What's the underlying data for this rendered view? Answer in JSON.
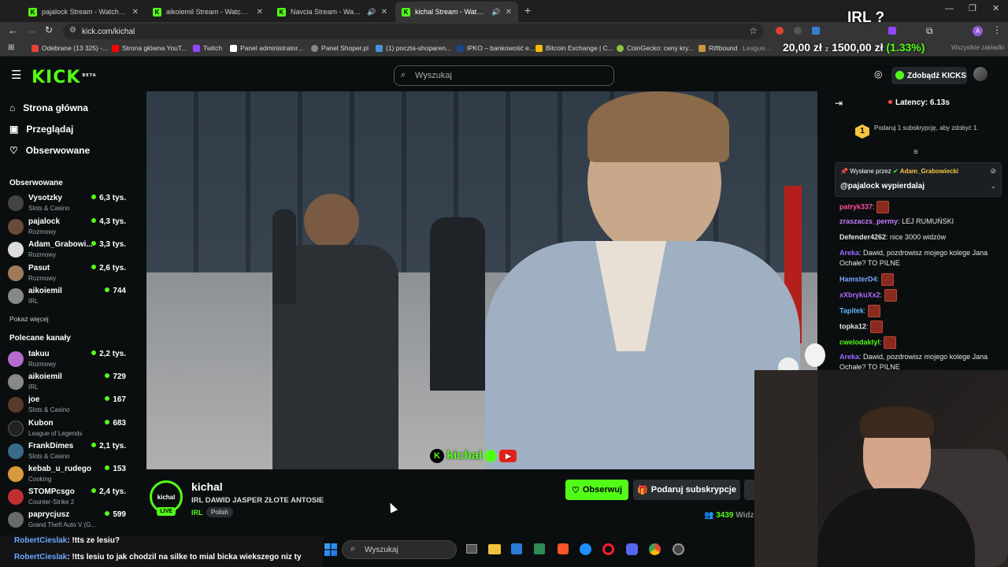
{
  "browser": {
    "tabs": [
      {
        "title": "pajalock Stream - Watch Live on",
        "active": false
      },
      {
        "title": "aikoiemil Stream - Watch Live o",
        "active": false
      },
      {
        "title": "Navcia Stream - Watch Live on",
        "active": false
      },
      {
        "title": "kichal Stream - Watch Live o",
        "active": true
      }
    ],
    "url": "kick.com/kichal",
    "bookmarks": [
      "Odebrane (13 325) -...",
      "Strona główna YouT...",
      "Twitch",
      "Panel administrator...",
      "Panel Shoper.pl",
      "(1) poczta-shoparen...",
      "iPKO – bankowość e...",
      "Bitcoin Exchange | C...",
      "CoinGecko: ceny kry...",
      "Riftbound",
      "League...",
      "Wszystkie zakładki"
    ]
  },
  "overlay": {
    "irl_label": "IRL ?",
    "ticker_left": "20,00 zł",
    "ticker_right": "1500,00 zł",
    "ticker_pct": "(1.33%)"
  },
  "header": {
    "logo": "KICK",
    "logo_beta": "BETA",
    "search_placeholder": "Wyszukaj",
    "kicks_button": "Zdobądź KICKS"
  },
  "sidebar": {
    "nav": [
      "Strona główna",
      "Przeglądaj",
      "Obserwowane"
    ],
    "followed_title": "Obserwowane",
    "followed": [
      {
        "name": "Vysotzky",
        "category": "Slots & Casino",
        "viewers": "6,3 tys."
      },
      {
        "name": "pajalock",
        "category": "Rozmowy",
        "viewers": "4,3 tys."
      },
      {
        "name": "Adam_Grabowi...",
        "category": "Rozmowy",
        "viewers": "3,3 tys."
      },
      {
        "name": "Pasut",
        "category": "Rozmowy",
        "viewers": "2,6 tys."
      },
      {
        "name": "aikoiemil",
        "category": "IRL",
        "viewers": "744"
      }
    ],
    "show_more": "Pokaż więcej",
    "recommended_title": "Polecane kanały",
    "recommended": [
      {
        "name": "takuu",
        "category": "Rozmowy",
        "viewers": "2,2 tys."
      },
      {
        "name": "aikoiemil",
        "category": "IRL",
        "viewers": "729"
      },
      {
        "name": "joe",
        "category": "Slots & Casino",
        "viewers": "167"
      },
      {
        "name": "Kubon",
        "category": "League of Legends",
        "viewers": "683"
      },
      {
        "name": "FrankDimes",
        "category": "Slots & Casino",
        "viewers": "2,1 tys."
      },
      {
        "name": "kebab_u_rudego",
        "category": "Cooking",
        "viewers": "153"
      },
      {
        "name": "STOMPcsgo",
        "category": "Counter-Strike 2",
        "viewers": "2,4 tys."
      },
      {
        "name": "paprycjusz",
        "category": "Grand Theft Auto V (G...",
        "viewers": "599"
      }
    ]
  },
  "video": {
    "watermark": "kichal"
  },
  "stream": {
    "channel": "kichal",
    "avatar_text": "kichal",
    "live_badge": "LIVE",
    "title": "IRL DAWID JASPER ZŁOTE ANTOSIE",
    "category": "IRL",
    "language_tag": "Polish",
    "follow_button": "Obserwuj",
    "gift_button": "Podaruj subskrypcje",
    "viewers": "3439",
    "viewers_label": "Widz"
  },
  "chat": {
    "latency": "Latency: 6.13s",
    "gift_goal_number": "1",
    "gift_goal_text": "Podaruj 1 subskrypcję, aby zdobyć 1.",
    "pinned_by_label": "Wysłane przez",
    "pinned_by_user": "Adam_Grabowiecki",
    "pinned_text": "@pajalock wypierdalaj",
    "messages": [
      {
        "user": "patryk337",
        "text": ":",
        "color": "#ff4fa0"
      },
      {
        "user": "zraszaczs_permy",
        "text": ": LEJ RUMUŃSKI",
        "color": "#c77dff"
      },
      {
        "user": "Defender4262",
        "text": ": nice 3000 widzów",
        "color": "#e6e6e6"
      },
      {
        "user": "Areka",
        "text": ": Dawid, pozdrowisz mojego kolege Jana Ochałe? TO PILNE",
        "color": "#9b6bff"
      },
      {
        "user": "HamsterD4",
        "text": ":",
        "color": "#7aa7ff"
      },
      {
        "user": "xXbrykuXx2",
        "text": ":",
        "color": "#b06bff"
      },
      {
        "user": "Tapitek",
        "text": ":",
        "color": "#5db8ff"
      },
      {
        "user": "topka12",
        "text": ":",
        "color": "#e6e6e6"
      },
      {
        "user": "cwelodaktyl",
        "text": ":",
        "color": "#53fc18"
      },
      {
        "user": "Areka",
        "text": ": Dawid, pozdrowisz mojego kolege Jana Ochałe? TO PILNE",
        "color": "#9b6bff"
      }
    ]
  },
  "bottom_chat": [
    {
      "user": "RobertCieslak",
      "text": ": !tts ze lesiu?"
    },
    {
      "user": "RobertCieslak",
      "text": ": !tts lesiu to jak chodzil na silke to mial bicka wiekszego niz ty"
    }
  ],
  "taskbar": {
    "search_placeholder": "Wyszukaj"
  },
  "colors": {
    "kick_green": "#53fc18",
    "background": "#0b0e0f",
    "chrome_bar": "#353535"
  }
}
